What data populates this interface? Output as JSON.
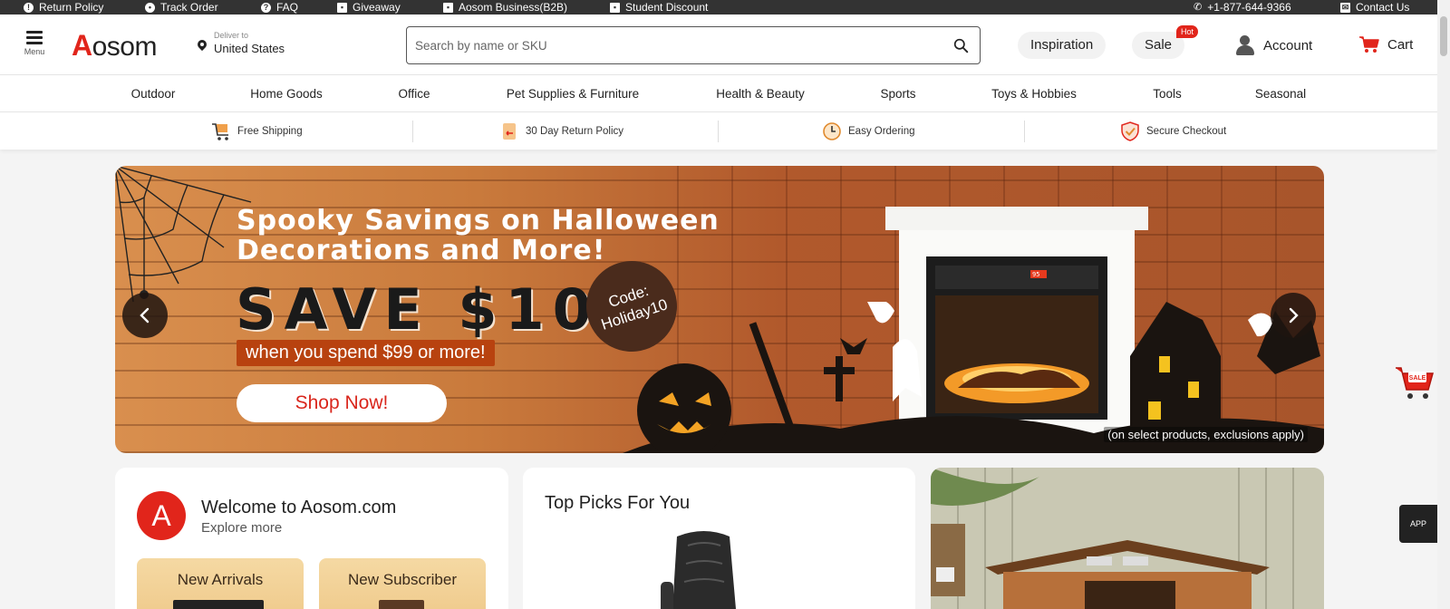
{
  "topbar": {
    "items": [
      {
        "label": "Return Policy",
        "icon": "info-icon"
      },
      {
        "label": "Track Order",
        "icon": "truck-icon"
      },
      {
        "label": "FAQ",
        "icon": "question-icon"
      },
      {
        "label": "Giveaway",
        "icon": "gift-icon"
      },
      {
        "label": "Aosom Business(B2B)",
        "icon": "briefcase-icon"
      },
      {
        "label": "Student Discount",
        "icon": "gift-icon"
      },
      {
        "label": "+1-877-644-9366",
        "icon": "phone-icon"
      },
      {
        "label": "Contact Us",
        "icon": "mail-icon"
      }
    ]
  },
  "header": {
    "menu_label": "Menu",
    "logo_first": "A",
    "logo_rest": "osom",
    "deliver_label": "Deliver to",
    "deliver_value": "United States",
    "search_placeholder": "Search by name or SKU",
    "inspiration": "Inspiration",
    "sale": "Sale",
    "hot": "Hot",
    "account": "Account",
    "cart": "Cart"
  },
  "categories": [
    "Outdoor",
    "Home Goods",
    "Office",
    "Pet Supplies & Furniture",
    "Health & Beauty",
    "Sports",
    "Toys & Hobbies",
    "Tools",
    "Seasonal"
  ],
  "benefits": [
    {
      "label": "Free Shipping",
      "icon": "shipping-cart-icon"
    },
    {
      "label": "30 Day Return Policy",
      "icon": "return-box-icon"
    },
    {
      "label": "Easy Ordering",
      "icon": "clock-24-icon"
    },
    {
      "label": "Secure Checkout",
      "icon": "shield-check-icon"
    }
  ],
  "hero": {
    "headline_line1": "Spooky Savings on Halloween",
    "headline_line2": "Decorations and More!",
    "save": "SAVE $10",
    "spend": "when you spend $99 or more!",
    "cta": "Shop Now!",
    "code_line1": "Code:",
    "code_line2": "Holiday10",
    "fine_print": "(on select products, exclusions apply)",
    "fireplace_display": "95"
  },
  "welcome": {
    "avatar_letter": "A",
    "title": "Welcome to Aosom.com",
    "subtitle": "Explore more",
    "tiles": [
      "New Arrivals",
      "New Subscriber"
    ]
  },
  "picks": {
    "title": "Top Picks For You"
  },
  "floating": {
    "sale_cart_label": "SALE",
    "app_label": "APP"
  },
  "colors": {
    "brand_red": "#e1251b",
    "topbar": "#333333",
    "hero_orange": "#c97a3c"
  }
}
